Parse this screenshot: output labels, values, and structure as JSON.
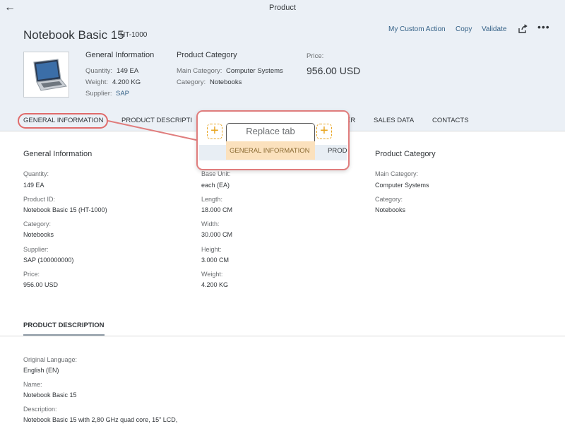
{
  "shell": {
    "title": "Product",
    "back_icon": "←"
  },
  "header": {
    "title": "Notebook Basic 15",
    "subtitle": "HT-1000",
    "actions": {
      "custom": "My Custom Action",
      "copy": "Copy",
      "validate": "Validate",
      "share_icon": "share-icon",
      "more": "•••"
    },
    "general": {
      "title": "General Information",
      "quantity_label": "Quantity:",
      "quantity_value": "149 EA",
      "weight_label": "Weight:",
      "weight_value": "4.200 KG",
      "supplier_label": "Supplier:",
      "supplier_value": "SAP"
    },
    "category": {
      "title": "Product Category",
      "main_label": "Main Category:",
      "main_value": "Computer Systems",
      "cat_label": "Category:",
      "cat_value": "Notebooks"
    },
    "price": {
      "label": "Price:",
      "value": "956.00  USD"
    }
  },
  "tabs": [
    "GENERAL INFORMATION",
    "PRODUCT DESCRIPTI",
    "ER",
    "SALES DATA",
    "CONTACTS"
  ],
  "callout": {
    "replace_label": "Replace tab",
    "active_tab": "GENERAL INFORMATION",
    "next_tab": "PROD",
    "plus": "+"
  },
  "general_section": {
    "col1": {
      "title": "General Information",
      "fields": [
        {
          "label": "Quantity:",
          "value": "149 EA"
        },
        {
          "label": "Product ID:",
          "value": "Notebook Basic 15 (HT-1000)"
        },
        {
          "label": "Category:",
          "value": "Notebooks"
        },
        {
          "label": "Supplier:",
          "value": "SAP (100000000)"
        },
        {
          "label": "Price:",
          "value": "956.00  USD"
        }
      ]
    },
    "col2": {
      "fields": [
        {
          "label": "Base Unit:",
          "value": "each (EA)"
        },
        {
          "label": "Length:",
          "value": "18.000 CM"
        },
        {
          "label": "Width:",
          "value": "30.000 CM"
        },
        {
          "label": "Height:",
          "value": "3.000 CM"
        },
        {
          "label": "Weight:",
          "value": "4.200 KG"
        }
      ]
    },
    "col3": {
      "title": "Product Category",
      "fields": [
        {
          "label": "Main Category:",
          "value": "Computer Systems"
        },
        {
          "label": "Category:",
          "value": "Notebooks"
        }
      ]
    }
  },
  "product_description": {
    "title": "PRODUCT DESCRIPTION",
    "fields": [
      {
        "label": "Original Language:",
        "value": "English (EN)"
      },
      {
        "label": "Name:",
        "value": "Notebook Basic 15"
      },
      {
        "label": "Description:",
        "value": "Notebook Basic 15 with 2,80 GHz quad core, 15\" LCD,"
      }
    ]
  },
  "colors": {
    "header_bg": "#ebf0f6",
    "link": "#346187",
    "highlight": "#e06b6b",
    "accent_orange": "#e8a41e",
    "active_tab_bg": "#fbe1bd"
  }
}
